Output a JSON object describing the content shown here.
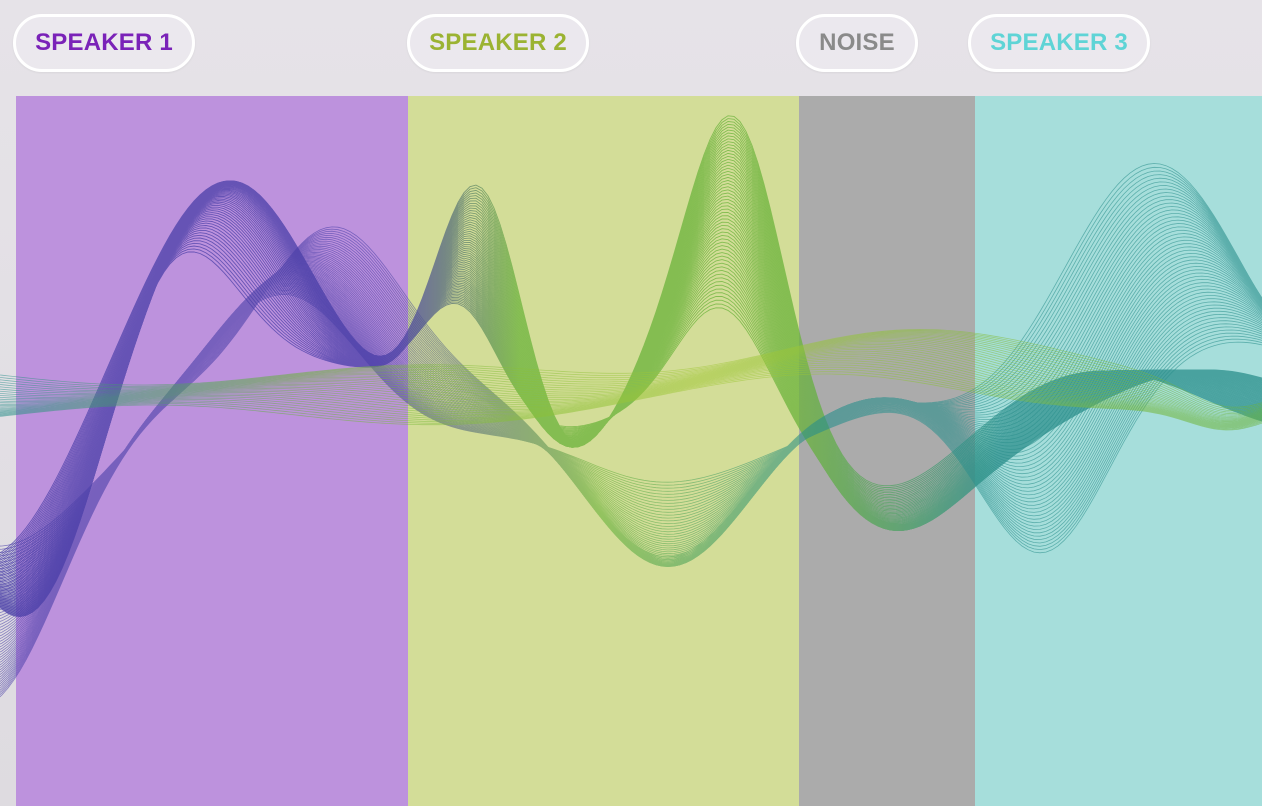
{
  "speakers": [
    {
      "id": "speaker-1",
      "label": "SPEAKER 1",
      "label_color": "#7a22b8",
      "band_color": "#bd92dd"
    },
    {
      "id": "speaker-2",
      "label": "SPEAKER 2",
      "label_color": "#9bb332",
      "band_color": "#d3dd98"
    },
    {
      "id": "noise",
      "label": "NOISE",
      "label_color": "#8a8a8a",
      "band_color": "#ababab"
    },
    {
      "id": "speaker-3",
      "label": "SPEAKER 3",
      "label_color": "#5fd4d6",
      "band_color": "#a6dedb"
    }
  ],
  "colors": {
    "background": "#e0dde2",
    "pill_border": "#ffffff",
    "wave_purple": "#4a3fa8",
    "wave_green": "#6ab33a",
    "wave_teal": "#2a8f8c",
    "wave_lime": "#a3c93a"
  }
}
